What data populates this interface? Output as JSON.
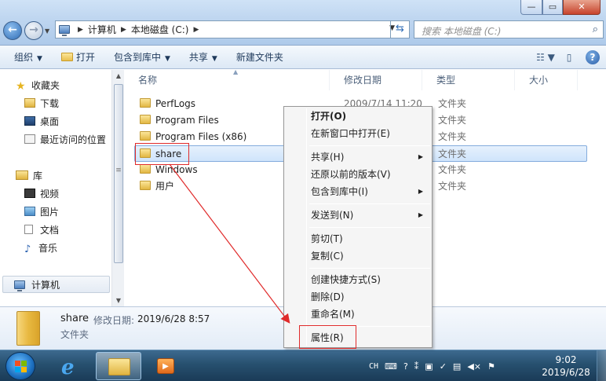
{
  "window": {
    "controls": {
      "minimize": "—",
      "maximize": "▭",
      "close": "✕"
    }
  },
  "address_bar": {
    "crumbs": [
      "计算机",
      "本地磁盘 (C:)"
    ]
  },
  "search": {
    "placeholder": "搜索 本地磁盘 (C:)"
  },
  "toolbar": {
    "organize": "组织",
    "open": "打开",
    "include_in_library": "包含到库中",
    "share": "共享",
    "new_folder": "新建文件夹"
  },
  "nav": {
    "favorites": "收藏夹",
    "downloads": "下载",
    "desktop": "桌面",
    "recent_places": "最近访问的位置",
    "libraries": "库",
    "videos": "视频",
    "pictures": "图片",
    "documents": "文档",
    "music": "音乐",
    "computer": "计算机"
  },
  "columns": {
    "name": "名称",
    "date_modified": "修改日期",
    "type": "类型",
    "size": "大小"
  },
  "files": [
    {
      "name": "PerfLogs",
      "date": "2009/7/14 11:20",
      "type": "文件夹"
    },
    {
      "name": "Program Files",
      "date": "",
      "type": "文件夹"
    },
    {
      "name": "Program Files (x86)",
      "date": "",
      "type": "文件夹"
    },
    {
      "name": "share",
      "date": "",
      "type": "文件夹"
    },
    {
      "name": "Windows",
      "date": "",
      "type": "文件夹"
    },
    {
      "name": "用户",
      "date": "",
      "type": "文件夹"
    }
  ],
  "context_menu": {
    "open": "打开(O)",
    "open_new_window": "在新窗口中打开(E)",
    "share": "共享(H)",
    "restore_previous": "还原以前的版本(V)",
    "include_in_library": "包含到库中(I)",
    "send_to": "发送到(N)",
    "cut": "剪切(T)",
    "copy": "复制(C)",
    "create_shortcut": "创建快捷方式(S)",
    "delete": "删除(D)",
    "rename": "重命名(M)",
    "properties": "属性(R)"
  },
  "details": {
    "name": "share",
    "date_label": "修改日期:",
    "date": "2019/6/28 8:57",
    "type": "文件夹"
  },
  "taskbar": {
    "language": "CH",
    "time": "9:02",
    "date": "2019/6/28"
  },
  "colors": {
    "selection_border": "#84acdd",
    "annotation_red": "#e02a2a",
    "taskbar": "#27506f"
  }
}
